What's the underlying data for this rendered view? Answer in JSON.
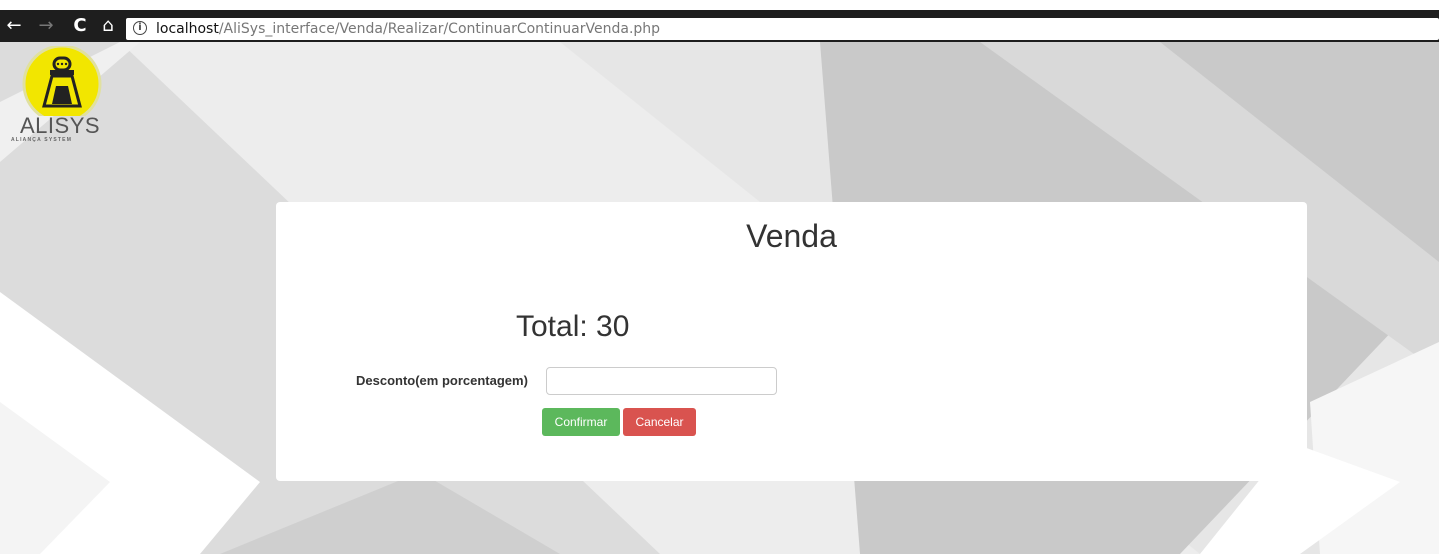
{
  "browser": {
    "back_icon": "←",
    "forward_icon": "→",
    "reload_icon": "C",
    "home_icon": "⌂",
    "info_icon": "i",
    "url_host": "localhost",
    "url_path": "/AliSys_interface/Venda/Realizar/ContinuarContinuarVenda.php"
  },
  "logo": {
    "text": "ALISYS",
    "subtext": "ALIANÇA SYSTEM"
  },
  "panel": {
    "title": "Venda",
    "total": "Total: 30",
    "discount_label": "Desconto(em porcentagem)",
    "discount_value": "",
    "confirm_label": "Confirmar",
    "cancel_label": "Cancelar"
  },
  "colors": {
    "confirm": "#5cb85c",
    "cancel": "#d9534f",
    "logo_yellow": "#f2e600"
  }
}
